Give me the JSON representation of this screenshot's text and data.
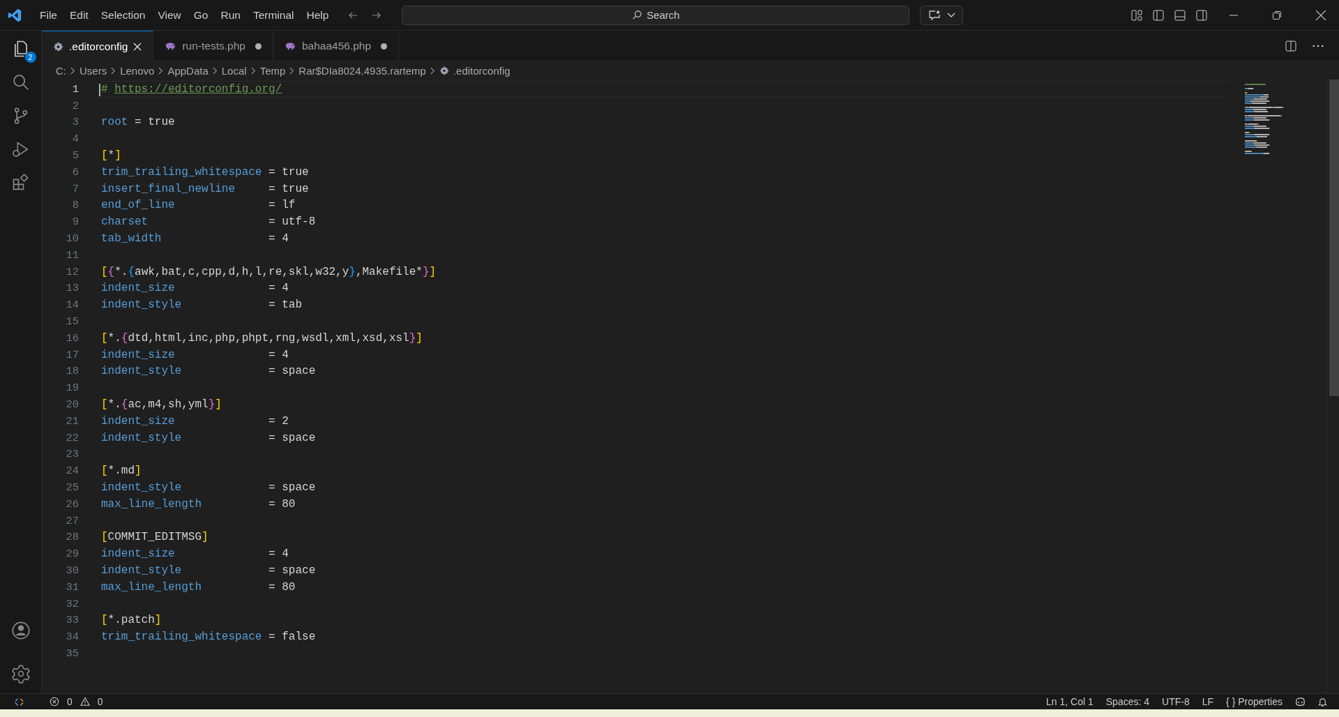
{
  "menu": [
    "File",
    "Edit",
    "Selection",
    "View",
    "Go",
    "Run",
    "Terminal",
    "Help"
  ],
  "search": {
    "placeholder": "Search"
  },
  "activity_bar": {
    "explorer_badge": "2"
  },
  "tabs": [
    {
      "label": ".editorconfig",
      "kind": "config",
      "selected": true,
      "modified": false
    },
    {
      "label": "run-tests.php",
      "kind": "php",
      "selected": false,
      "modified": true
    },
    {
      "label": "bahaa456.php",
      "kind": "php",
      "selected": false,
      "modified": true
    }
  ],
  "breadcrumb": [
    "C:",
    "Users",
    "Lenovo",
    "AppData",
    "Local",
    "Temp",
    "Rar$DIa8024.4935.rartemp",
    ".editorconfig"
  ],
  "lines": [
    {
      "number": "1",
      "current": true,
      "tokens": [
        {
          "kind": "comment",
          "text": "# "
        },
        {
          "kind": "link",
          "text": "https://editorconfig.org/"
        }
      ]
    },
    {
      "number": "2",
      "current": false
    },
    {
      "number": "3",
      "current": false,
      "tokens": [
        {
          "kind": "key",
          "text": "root"
        },
        {
          "kind": "text",
          "text": " = true"
        }
      ]
    },
    {
      "number": "4",
      "current": false
    },
    {
      "number": "5",
      "current": false,
      "tokens": [
        {
          "kind": "bracket1",
          "text": "["
        },
        {
          "kind": "text",
          "text": "*"
        },
        {
          "kind": "bracket1",
          "text": "]"
        }
      ]
    },
    {
      "number": "6",
      "current": false,
      "tokens": [
        {
          "kind": "key",
          "text": "trim_trailing_whitespace"
        },
        {
          "kind": "text",
          "text": " = true"
        }
      ]
    },
    {
      "number": "7",
      "current": false,
      "tokens": [
        {
          "kind": "key",
          "text": "insert_final_newline"
        },
        {
          "kind": "text",
          "text": "     = true"
        }
      ]
    },
    {
      "number": "8",
      "current": false,
      "tokens": [
        {
          "kind": "key",
          "text": "end_of_line"
        },
        {
          "kind": "text",
          "text": "              = lf"
        }
      ]
    },
    {
      "number": "9",
      "current": false,
      "tokens": [
        {
          "kind": "key",
          "text": "charset"
        },
        {
          "kind": "text",
          "text": "                  = utf-8"
        }
      ]
    },
    {
      "number": "10",
      "current": false,
      "tokens": [
        {
          "kind": "key",
          "text": "tab_width"
        },
        {
          "kind": "text",
          "text": "                = 4"
        }
      ]
    },
    {
      "number": "11",
      "current": false
    },
    {
      "number": "12",
      "current": false,
      "tokens": [
        {
          "kind": "bracket1",
          "text": "["
        },
        {
          "kind": "bracket2",
          "text": "{"
        },
        {
          "kind": "text",
          "text": "*."
        },
        {
          "kind": "bracket3",
          "text": "{"
        },
        {
          "kind": "text",
          "text": "awk,bat,c,cpp,d,h,l,re,skl,w32,y"
        },
        {
          "kind": "bracket3",
          "text": "}"
        },
        {
          "kind": "text",
          "text": ",Makefile*"
        },
        {
          "kind": "bracket2",
          "text": "}"
        },
        {
          "kind": "bracket1",
          "text": "]"
        }
      ]
    },
    {
      "number": "13",
      "current": false,
      "tokens": [
        {
          "kind": "key",
          "text": "indent_size"
        },
        {
          "kind": "text",
          "text": "              = 4"
        }
      ]
    },
    {
      "number": "14",
      "current": false,
      "tokens": [
        {
          "kind": "key",
          "text": "indent_style"
        },
        {
          "kind": "text",
          "text": "             = tab"
        }
      ]
    },
    {
      "number": "15",
      "current": false
    },
    {
      "number": "16",
      "current": false,
      "tokens": [
        {
          "kind": "bracket1",
          "text": "["
        },
        {
          "kind": "text",
          "text": "*."
        },
        {
          "kind": "bracket2",
          "text": "{"
        },
        {
          "kind": "text",
          "text": "dtd,html,inc,php,phpt,rng,wsdl,xml,xsd,xsl"
        },
        {
          "kind": "bracket2",
          "text": "}"
        },
        {
          "kind": "bracket1",
          "text": "]"
        }
      ]
    },
    {
      "number": "17",
      "current": false,
      "tokens": [
        {
          "kind": "key",
          "text": "indent_size"
        },
        {
          "kind": "text",
          "text": "              = 4"
        }
      ]
    },
    {
      "number": "18",
      "current": false,
      "tokens": [
        {
          "kind": "key",
          "text": "indent_style"
        },
        {
          "kind": "text",
          "text": "             = space"
        }
      ]
    },
    {
      "number": "19",
      "current": false
    },
    {
      "number": "20",
      "current": false,
      "tokens": [
        {
          "kind": "bracket1",
          "text": "["
        },
        {
          "kind": "text",
          "text": "*."
        },
        {
          "kind": "bracket2",
          "text": "{"
        },
        {
          "kind": "text",
          "text": "ac,m4,sh,yml"
        },
        {
          "kind": "bracket2",
          "text": "}"
        },
        {
          "kind": "bracket1",
          "text": "]"
        }
      ]
    },
    {
      "number": "21",
      "current": false,
      "tokens": [
        {
          "kind": "key",
          "text": "indent_size"
        },
        {
          "kind": "text",
          "text": "              = 2"
        }
      ]
    },
    {
      "number": "22",
      "current": false,
      "tokens": [
        {
          "kind": "key",
          "text": "indent_style"
        },
        {
          "kind": "text",
          "text": "             = space"
        }
      ]
    },
    {
      "number": "23",
      "current": false
    },
    {
      "number": "24",
      "current": false,
      "tokens": [
        {
          "kind": "bracket1",
          "text": "["
        },
        {
          "kind": "text",
          "text": "*.md"
        },
        {
          "kind": "bracket1",
          "text": "]"
        }
      ]
    },
    {
      "number": "25",
      "current": false,
      "tokens": [
        {
          "kind": "key",
          "text": "indent_style"
        },
        {
          "kind": "text",
          "text": "             = space"
        }
      ]
    },
    {
      "number": "26",
      "current": false,
      "tokens": [
        {
          "kind": "key",
          "text": "max_line_length"
        },
        {
          "kind": "text",
          "text": "          = 80"
        }
      ]
    },
    {
      "number": "27",
      "current": false
    },
    {
      "number": "28",
      "current": false,
      "tokens": [
        {
          "kind": "bracket1",
          "text": "["
        },
        {
          "kind": "text",
          "text": "COMMIT_EDITMSG"
        },
        {
          "kind": "bracket1",
          "text": "]"
        }
      ]
    },
    {
      "number": "29",
      "current": false,
      "tokens": [
        {
          "kind": "key",
          "text": "indent_size"
        },
        {
          "kind": "text",
          "text": "              = 4"
        }
      ]
    },
    {
      "number": "30",
      "current": false,
      "tokens": [
        {
          "kind": "key",
          "text": "indent_style"
        },
        {
          "kind": "text",
          "text": "             = space"
        }
      ]
    },
    {
      "number": "31",
      "current": false,
      "tokens": [
        {
          "kind": "key",
          "text": "max_line_length"
        },
        {
          "kind": "text",
          "text": "          = 80"
        }
      ]
    },
    {
      "number": "32",
      "current": false
    },
    {
      "number": "33",
      "current": false,
      "tokens": [
        {
          "kind": "bracket1",
          "text": "["
        },
        {
          "kind": "text",
          "text": "*.patch"
        },
        {
          "kind": "bracket1",
          "text": "]"
        }
      ]
    },
    {
      "number": "34",
      "current": false,
      "tokens": [
        {
          "kind": "key",
          "text": "trim_trailing_whitespace"
        },
        {
          "kind": "text",
          "text": " = false"
        }
      ]
    },
    {
      "number": "35",
      "current": false
    }
  ],
  "status_bar": {
    "errors": "0",
    "warnings": "0",
    "items": [
      "Ln 1, Col 1",
      "Spaces: 4",
      "UTF-8",
      "LF",
      "{ } Properties"
    ]
  }
}
